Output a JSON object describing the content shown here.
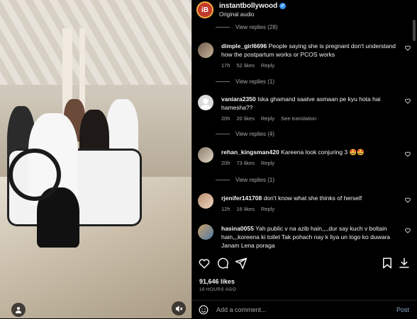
{
  "header": {
    "username": "instantbollywood",
    "verified_badge": "✓",
    "audio": "Original audio",
    "avatar_initial": "iB"
  },
  "comments": [
    {
      "type": "view_replies",
      "label": "View replies (28)"
    },
    {
      "type": "comment",
      "username": "dimple_girl6696",
      "text": "People saying she is pregnant don't understand how the postpartum works or PCOS works",
      "time": "17h",
      "likes": "52 likes",
      "reply": "Reply",
      "translation": ""
    },
    {
      "type": "view_replies",
      "label": "View replies (1)"
    },
    {
      "type": "comment",
      "username": "vaniara2350",
      "text": "Iska ghamand saatve asmaan pe kyu hota hai hamesha??",
      "time": "20h",
      "likes": "20 likes",
      "reply": "Reply",
      "translation": "See translation"
    },
    {
      "type": "view_replies",
      "label": "View replies (4)"
    },
    {
      "type": "comment",
      "username": "rehan_kingsman420",
      "text": "Kareena look conjuring 3 🤩🤩",
      "time": "20h",
      "likes": "73 likes",
      "reply": "Reply",
      "translation": ""
    },
    {
      "type": "view_replies",
      "label": "View replies (1)"
    },
    {
      "type": "comment",
      "username": "rjenifer141708",
      "text": "don't know what she thinks of herself",
      "time": "12h",
      "likes": "16 likes",
      "reply": "Reply",
      "translation": ""
    },
    {
      "type": "comment",
      "username": "hasina0055",
      "text": "Yah public v na azib hain,,,,dur say kuch v boltain hain,,,koreena ki toilet Tak pohach nay k liya un logo ko duwara Janam Lena poraga",
      "time": "",
      "likes": "",
      "reply": "",
      "translation": ""
    }
  ],
  "actions": {
    "like_icon": "heart-icon",
    "comment_icon": "comment-icon",
    "share_icon": "share-icon",
    "save_icon": "bookmark-icon",
    "download_icon": "download-icon"
  },
  "stats": {
    "likes": "91,646 likes",
    "time": "19 HOURS AGO"
  },
  "composer": {
    "placeholder": "Add a comment...",
    "post_label": "Post"
  },
  "colors": {
    "background": "#000000",
    "text": "#f5f5f5",
    "muted": "#a8a8a8",
    "verified": "#3897f0",
    "post_disabled": "#8aa7c9"
  }
}
